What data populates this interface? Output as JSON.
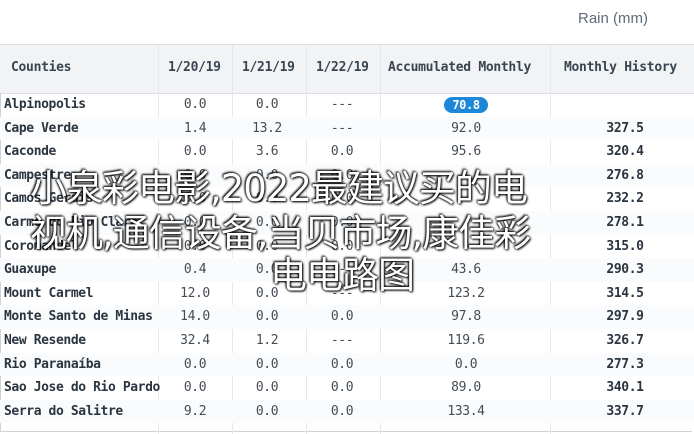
{
  "unit_label": "Rain (mm)",
  "headers": {
    "county": "Counties",
    "d1": "1/20/19",
    "d2": "1/21/19",
    "d3": "1/22/19",
    "acc": "Accumulated Monthly",
    "mh": "Monthly History"
  },
  "rows": [
    {
      "county": "Alpinopolis",
      "d1": "0.0",
      "d2": "0.0",
      "d3": "---",
      "acc": "70.8",
      "mh": ""
    },
    {
      "county": "Cape Verde",
      "d1": "1.4",
      "d2": "13.2",
      "d3": "---",
      "acc": "92.0",
      "mh": "327.5"
    },
    {
      "county": "Caconde",
      "d1": "0.0",
      "d2": "3.6",
      "d3": "0.0",
      "acc": "95.6",
      "mh": "320.4"
    },
    {
      "county": "Campestre",
      "d1": "0.0",
      "d2": "0.0",
      "d3": "0.0",
      "acc": "",
      "mh": "276.8"
    },
    {
      "county": "Camos Gerais",
      "d1": "0.0",
      "d2": "0.0",
      "d3": "0.0",
      "acc": "",
      "mh": "232.2"
    },
    {
      "county": "Carmo do Rio Claro",
      "d1": "0.0",
      "d2": "0.0",
      "d3": "0.0",
      "acc": "",
      "mh": "278.1"
    },
    {
      "county": "Coromandel",
      "d1": "0.0",
      "d2": "0.0",
      "d3": "0.0",
      "acc": "",
      "mh": "315.0"
    },
    {
      "county": "Guaxupe",
      "d1": "0.4",
      "d2": "0.0",
      "d3": "---",
      "acc": "43.6",
      "mh": "290.3"
    },
    {
      "county": "Mount Carmel",
      "d1": "12.0",
      "d2": "0.0",
      "d3": "---",
      "acc": "123.2",
      "mh": "314.5"
    },
    {
      "county": "Monte Santo de Minas",
      "d1": "14.0",
      "d2": "0.0",
      "d3": "0.0",
      "acc": "97.8",
      "mh": "297.9"
    },
    {
      "county": "New Resende",
      "d1": "32.4",
      "d2": "1.2",
      "d3": "---",
      "acc": "119.6",
      "mh": "326.7"
    },
    {
      "county": "Rio Paranaíba",
      "d1": "0.0",
      "d2": "0.0",
      "d3": "0.0",
      "acc": "0.0",
      "mh": "277.3"
    },
    {
      "county": "Sao Jose do Rio Pardo",
      "d1": "0.0",
      "d2": "0.0",
      "d3": "0.0",
      "acc": "89.0",
      "mh": "340.1"
    },
    {
      "county": "Serra do Salitre",
      "d1": "9.2",
      "d2": "0.0",
      "d3": "0.0",
      "acc": "133.4",
      "mh": "337.7"
    }
  ],
  "overlay": {
    "line1": "小泉彩电影,2022最建议买的电",
    "line2": "视机,通信设备,当贝市场,康佳彩",
    "line3": "电电路图"
  },
  "colors": {
    "badge": "#1e88d8",
    "header_bg": "#f1f3f5"
  }
}
